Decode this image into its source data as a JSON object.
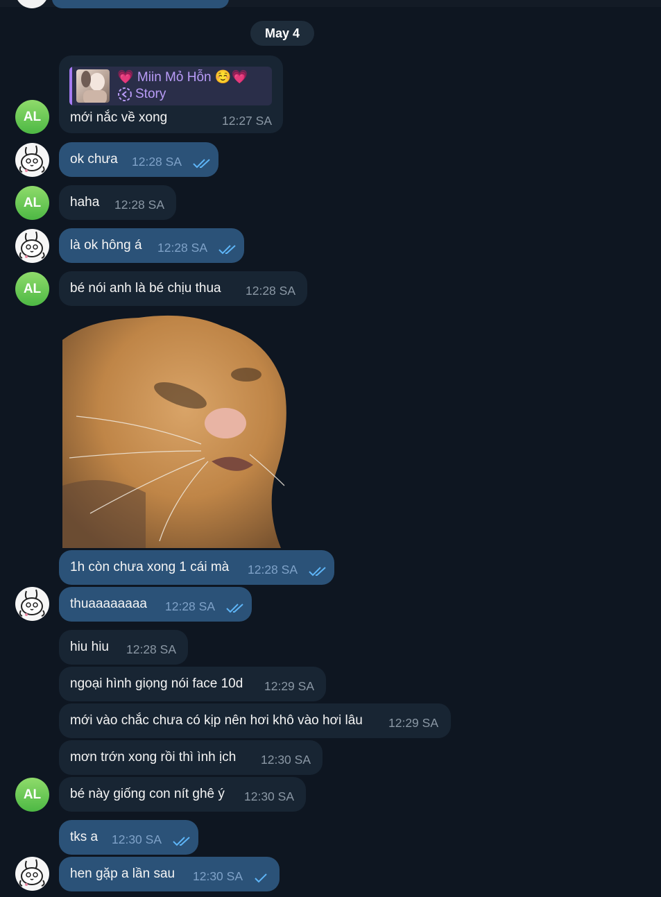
{
  "date_label": "May 4",
  "reply": {
    "name": "💗 Miin Mỏ Hỗn ☺️💗",
    "subtitle": "Story"
  },
  "avatars": {
    "other_initials": "AL"
  },
  "messages": [
    {
      "text": "mới nắc về xong",
      "time": "12:27 SA",
      "outgoing": false
    },
    {
      "text": "ok chưa",
      "time": "12:28 SA",
      "outgoing": true,
      "status": "read"
    },
    {
      "text": "haha",
      "time": "12:28 SA",
      "outgoing": false
    },
    {
      "text": "là ok hông á",
      "time": "12:28 SA",
      "outgoing": true,
      "status": "read"
    },
    {
      "text": "bé nói anh là bé chịu thua",
      "time": "12:28 SA",
      "outgoing": false
    },
    {
      "text": "1h còn chưa xong 1 cái mà",
      "time": "12:28 SA",
      "outgoing": true,
      "status": "read"
    },
    {
      "text": "thuaaaaaaaa",
      "time": "12:28 SA",
      "outgoing": true,
      "status": "read"
    },
    {
      "text": "hiu hiu",
      "time": "12:28 SA",
      "outgoing": false
    },
    {
      "text": "ngoại hình giọng nói face 10d",
      "time": "12:29 SA",
      "outgoing": false
    },
    {
      "text": "mới vào chắc chưa có kịp nên hơi khô vào hơi lâu",
      "time": "12:29 SA",
      "outgoing": false
    },
    {
      "text": "mơn trớn xong rồi thì ình ịch",
      "time": "12:30 SA",
      "outgoing": false
    },
    {
      "text": "bé này giống con nít ghê ý",
      "time": "12:30 SA",
      "outgoing": false
    },
    {
      "text": "tks a",
      "time": "12:30 SA",
      "outgoing": true,
      "status": "read"
    },
    {
      "text": "hen gặp a lần sau",
      "time": "12:30 SA",
      "outgoing": true,
      "status": "sent"
    }
  ],
  "colors": {
    "background": "#0e1621",
    "incoming_bubble": "#182533",
    "outgoing_bubble": "#2b5278",
    "tick": "#5eb5f7",
    "reply_accent": "#a57bf2"
  }
}
